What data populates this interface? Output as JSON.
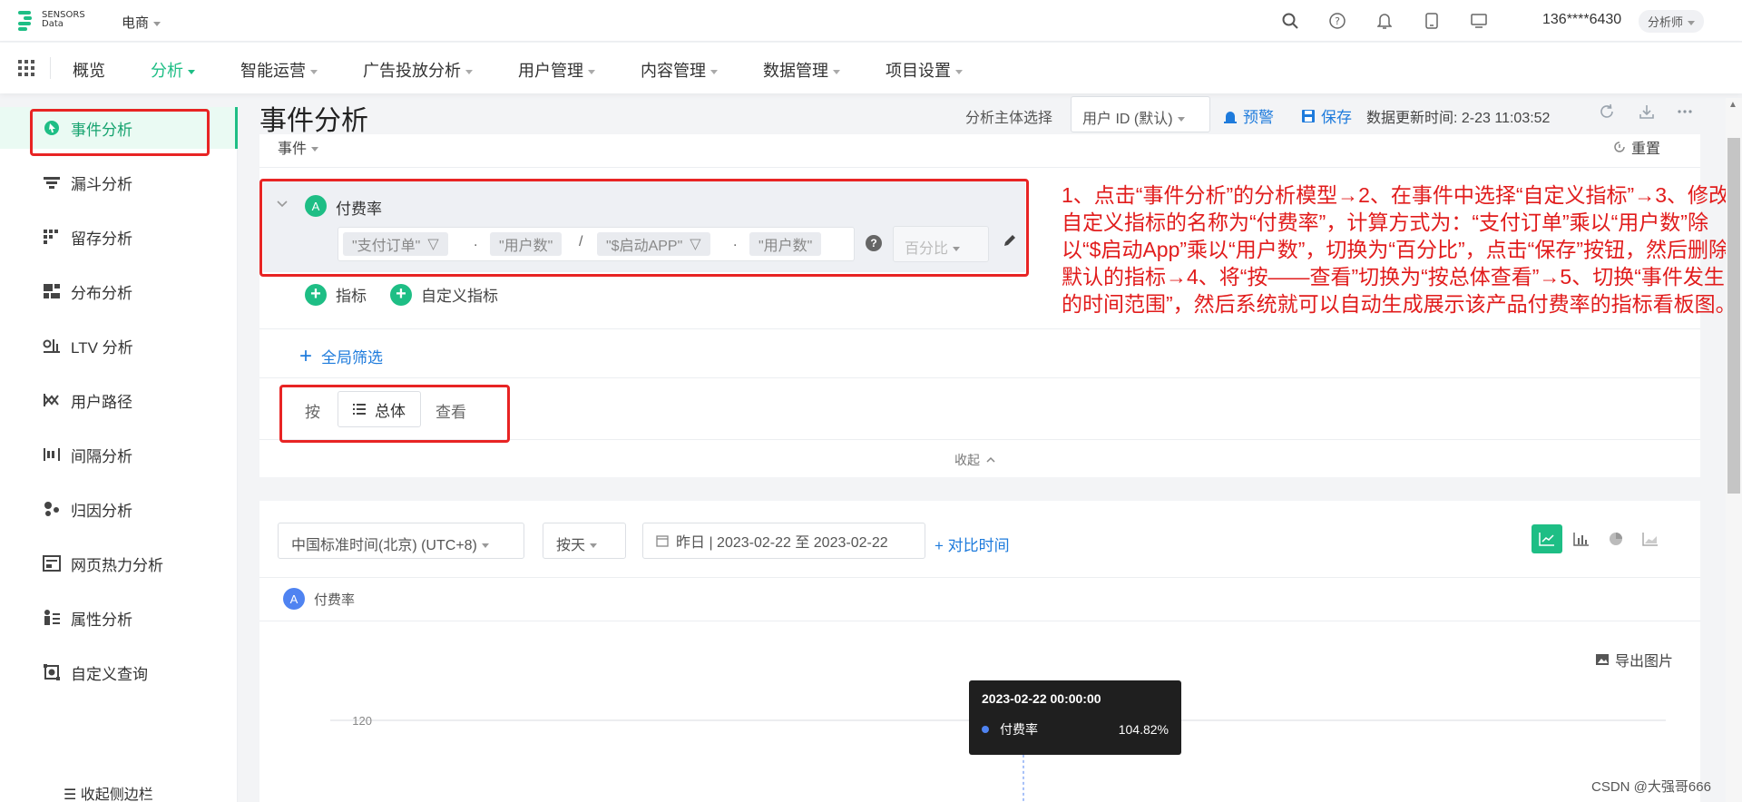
{
  "brand": {
    "logo_line1": "SENSORS",
    "logo_line2": "Data",
    "accent": "#1ebe85",
    "link": "#1e7bdc"
  },
  "project": "电商",
  "top_icons": [
    "search-icon",
    "help-icon",
    "bell-icon",
    "phone-icon",
    "monitor-icon"
  ],
  "user": {
    "phone": "136****6430",
    "role": "分析师"
  },
  "nav": {
    "items": [
      {
        "label": "概览",
        "dropdown": false
      },
      {
        "label": "分析",
        "dropdown": true,
        "active": true
      },
      {
        "label": "智能运营",
        "dropdown": true
      },
      {
        "label": "广告投放分析",
        "dropdown": true
      },
      {
        "label": "用户管理",
        "dropdown": true
      },
      {
        "label": "内容管理",
        "dropdown": true
      },
      {
        "label": "数据管理",
        "dropdown": true
      },
      {
        "label": "项目设置",
        "dropdown": true
      }
    ]
  },
  "sidebar": {
    "items": [
      {
        "label": "事件分析",
        "icon": "event-analysis-icon",
        "active": true
      },
      {
        "label": "漏斗分析",
        "icon": "funnel-icon"
      },
      {
        "label": "留存分析",
        "icon": "retention-icon"
      },
      {
        "label": "分布分析",
        "icon": "distribution-icon"
      },
      {
        "label": "LTV 分析",
        "icon": "ltv-icon"
      },
      {
        "label": "用户路径",
        "icon": "user-path-icon"
      },
      {
        "label": "间隔分析",
        "icon": "interval-icon"
      },
      {
        "label": "归因分析",
        "icon": "attribution-icon"
      },
      {
        "label": "网页热力分析",
        "icon": "heatmap-icon"
      },
      {
        "label": "属性分析",
        "icon": "attribute-icon"
      },
      {
        "label": "自定义查询",
        "icon": "custom-query-icon"
      }
    ],
    "collapse_label": "收起侧边栏"
  },
  "header": {
    "title": "事件分析",
    "subject_label": "分析主体选择",
    "subject_value": "用户 ID (默认)",
    "alert_label": "预警",
    "save_label": "保存",
    "update_time": "数据更新时间: 2-23 11:03:52"
  },
  "query": {
    "section_label": "事件",
    "reset_label": "重置",
    "metric": {
      "badge": "A",
      "name": "付费率",
      "formula": [
        "\"支付订单\"",
        ".",
        "\"用户数\"",
        "/",
        "\"$启动APP\"",
        ".",
        "\"用户数\""
      ],
      "display_type": "百分比"
    },
    "add_metric_label": "指标",
    "add_custom_metric_label": "自定义指标",
    "global_filter_label": "全局筛选",
    "by_label": "按",
    "group_value": "总体",
    "view_label": "查看",
    "collapse_label": "收起"
  },
  "annotation": "1、点击“事件分析”的分析模型→2、在事件中选择“自定义指标”→3、修改自定义指标的名称为“付费率”，计算方式为：“支付订单”乘以“用户数”除以“$启动App”乘以“用户数”，切换为“百分比”，点击“保存”按钮，然后删除默认的指标→4、将“按——查看”切换为“按总体查看”→5、切换“事件发生的时间范围”，然后系统就可以自动生成展示该产品付费率的指标看板图。",
  "chart_controls": {
    "timezone": "中国标准时间(北京) (UTC+8)",
    "granularity": "按天",
    "date_range": "昨日 | 2023-02-22 至 2023-02-22",
    "compare_label": "对比时间",
    "chart_types": [
      "line-chart-icon",
      "bar-chart-icon",
      "pie-chart-icon",
      "area-chart-icon"
    ],
    "legend_badge": "A",
    "legend_label": "付费率",
    "export_label": "导出图片"
  },
  "chart_data": {
    "type": "line",
    "x": [
      "2023-02-22 00:00:00"
    ],
    "series": [
      {
        "name": "付费率",
        "values": [
          104.82
        ],
        "color": "#4f83f1"
      }
    ],
    "yticks": [
      "120"
    ],
    "tooltip": {
      "title": "2023-02-22 00:00:00",
      "label": "付费率",
      "value": "104.82%"
    }
  },
  "watermark": "CSDN @大强哥666"
}
